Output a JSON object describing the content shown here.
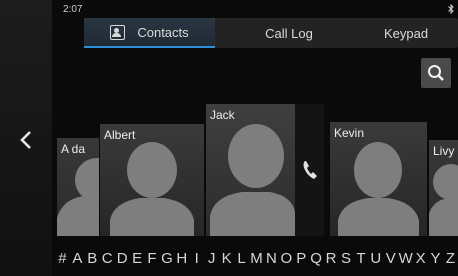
{
  "status": {
    "time": "2:07"
  },
  "tabs": [
    {
      "label": "Contacts",
      "active": true
    },
    {
      "label": "Call Log",
      "active": false
    },
    {
      "label": "Keypad",
      "active": false
    }
  ],
  "contacts": [
    {
      "name": "A da"
    },
    {
      "name": "Albert"
    },
    {
      "name": "Jack"
    },
    {
      "name": "Kevin"
    },
    {
      "name": "Livy"
    }
  ],
  "alphabet": [
    "#",
    "A",
    "B",
    "C",
    "D",
    "E",
    "F",
    "G",
    "H",
    "I",
    "J",
    "K",
    "L",
    "M",
    "N",
    "O",
    "P",
    "Q",
    "R",
    "S",
    "T",
    "U",
    "V",
    "W",
    "X",
    "Y",
    "Z"
  ],
  "icons": {
    "back": "chevron-left-icon",
    "search": "search-icon",
    "call": "phone-icon",
    "bluetooth": "bluetooth-icon",
    "contacts": "contacts-icon"
  },
  "colors": {
    "accent": "#2d8fd6",
    "background": "#0a0a0a",
    "card": "#333333"
  }
}
